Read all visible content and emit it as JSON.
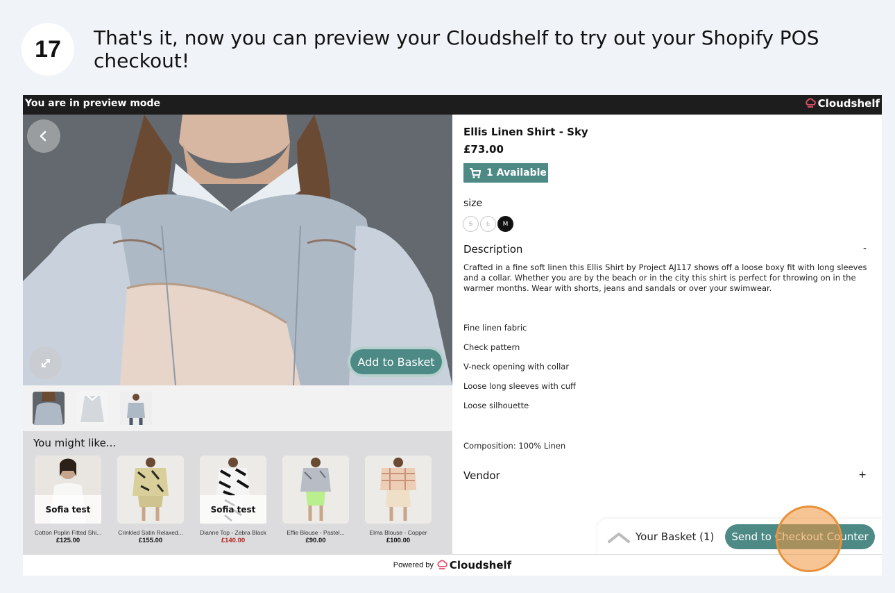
{
  "step": {
    "number": "17",
    "text": "That's it, now you can preview your Cloudshelf to try out your Shopify POS checkout!"
  },
  "preview_bar": {
    "mode_text": "You are in preview mode",
    "brand": "Cloudshelf",
    "brand_color": "#e8506b"
  },
  "gallery": {
    "back_icon": "chevron-left-icon",
    "expand_icon": "expand-icon",
    "add_to_basket": "Add to Basket",
    "thumbnails": [
      "thumbnail-1",
      "thumbnail-2",
      "thumbnail-3"
    ]
  },
  "recommendations": {
    "title": "You might like...",
    "items": [
      {
        "overlay": "Sofia test",
        "name": "Cotton Poplin Fitted Shi...",
        "price": "£125.00",
        "sale": false
      },
      {
        "overlay": "",
        "name": "Crinkled Satin Relaxed...",
        "price": "£155.00",
        "sale": false
      },
      {
        "overlay": "Sofia test",
        "name": "Dianne Top - Zebra Black",
        "price": "£140.00",
        "sale": true
      },
      {
        "overlay": "",
        "name": "Effie Blouse - Pastel...",
        "price": "£90.00",
        "sale": false
      },
      {
        "overlay": "",
        "name": "Elma Blouse - Copper",
        "price": "£100.00",
        "sale": false
      }
    ]
  },
  "product": {
    "title": "Ellis Linen Shirt - Sky",
    "price": "£73.00",
    "availability": "1 Available",
    "cart_icon": "cart-icon",
    "size_label": "size",
    "sizes": [
      {
        "label": "S",
        "active": false
      },
      {
        "label": "L",
        "active": false
      },
      {
        "label": "M",
        "active": true
      }
    ],
    "description_heading": "Description",
    "description_toggle": "-",
    "description": "Crafted in a fine soft linen this Ellis Shirt by Project AJ117 shows off a loose boxy fit with long sleeves and a collar. Whether you are by the beach or in the city this shirt is perfect for throwing on in the warmer months. Wear with shorts, jeans and sandals or over your swimwear.",
    "features": [
      "Fine linen fabric",
      "Check pattern",
      "V-neck opening with collar",
      "Loose long sleeves with cuff",
      "Loose silhouette"
    ],
    "composition": "Composition: 100% Linen",
    "vendor_heading": "Vendor",
    "vendor_toggle": "+"
  },
  "basket": {
    "label": "Your Basket",
    "count": "(1)",
    "checkout_button": "Send to Checkout Counter"
  },
  "footer": {
    "powered_by": "Powered by",
    "brand": "Cloudshelf"
  },
  "colors": {
    "accent": "#4d8a86",
    "highlight": "#e8913a",
    "sale": "#b3261e"
  }
}
